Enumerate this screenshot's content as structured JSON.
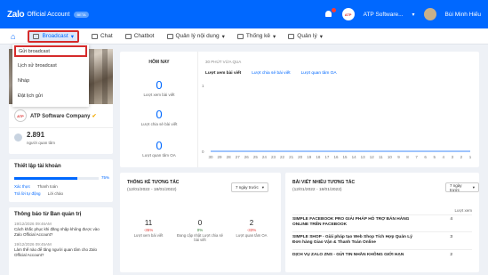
{
  "app": {
    "logo": "Zalo",
    "product": "Official Account",
    "badge": "BETA",
    "account_name": "ATP Software...",
    "account_logo": "ATP",
    "user_name": "Bùi Minh Hiếu"
  },
  "nav": {
    "items": [
      {
        "label": "Broadcast",
        "icon": "broadcast-icon"
      },
      {
        "label": "Chat",
        "icon": "chat-icon"
      },
      {
        "label": "Chatbot",
        "icon": "chatbot-icon"
      },
      {
        "label": "Quản lý nội dung",
        "icon": "content-icon"
      },
      {
        "label": "Thống kê",
        "icon": "stats-icon"
      },
      {
        "label": "Quản lý",
        "icon": "manage-icon"
      }
    ]
  },
  "dropdown": {
    "items": [
      "Gửi broadcast",
      "Lịch sử broadcast",
      "Nháp",
      "Đặt lịch gửi"
    ]
  },
  "profile": {
    "logo": "ATP",
    "name": "ATP Software Company",
    "followers": "2.891",
    "followers_label": "người quan tâm"
  },
  "setup": {
    "title": "Thiết lập tài khoản",
    "progress_percent": 75,
    "progress_label": "75%",
    "line1": [
      "Xác thực",
      "Thanh toán"
    ],
    "line2": [
      "Trả lời tự động",
      "Lời chào"
    ]
  },
  "notices": {
    "title": "Thông báo từ Ban quản trị",
    "items": [
      {
        "date": "19/12/2026 09:46AM",
        "text": "Cách khắc phục khi đăng nhập không được vào Zalo Official Account?"
      },
      {
        "date": "19/12/2026 09:45AM",
        "text": "Làm thế nào để tăng người quan tâm cho Zalo Official Account?"
      }
    ]
  },
  "today": {
    "title": "HÔM NAY",
    "stats": [
      {
        "value": "0",
        "label": "Lượt xem bài viết"
      },
      {
        "value": "0",
        "label": "Lượt chia sẻ bài viết"
      },
      {
        "value": "0",
        "label": "Lượt quan tâm OA"
      }
    ]
  },
  "chart": {
    "header": "30 PHÚT VỪA QUA",
    "tabs": [
      "Lượt xem bài viết",
      "Lượt chia sẻ bài viết",
      "Lượt quan tâm OA"
    ]
  },
  "chart_data": {
    "type": "line",
    "title": "",
    "xlabel": "",
    "ylabel": "",
    "x": [
      30,
      29,
      28,
      27,
      26,
      25,
      24,
      23,
      22,
      21,
      20,
      19,
      18,
      17,
      16,
      15,
      14,
      13,
      12,
      11,
      10,
      9,
      8,
      7,
      6,
      5,
      4,
      3,
      2,
      1
    ],
    "series": [
      {
        "values": [
          0,
          0,
          0,
          0,
          0,
          0,
          0,
          0,
          0,
          0,
          0,
          0,
          0,
          0,
          0,
          0,
          0,
          0,
          0,
          0,
          0,
          0,
          0,
          0,
          0,
          0,
          0,
          0,
          0,
          0
        ]
      }
    ],
    "y_ticks": [
      "1",
      "0"
    ],
    "ylim": [
      0,
      1
    ],
    "grid": false
  },
  "interaction": {
    "title": "THỐNG KÊ TƯƠNG TÁC",
    "range": "(12/01/2022 - 18/01/2022)",
    "select": "7 ngày trước",
    "stats": [
      {
        "value": "11",
        "delta": "-35%",
        "label": "Lượt xem bài viết"
      },
      {
        "value": "0",
        "delta": "0%",
        "label": "Đang cập nhật Lượt chia sẻ bài viết"
      },
      {
        "value": "2",
        "delta": "-33%",
        "label": "Lượt quan tâm OA"
      }
    ]
  },
  "top_posts": {
    "title": "BÀI VIẾT NHIỀU TƯƠNG TÁC",
    "range": "(12/01/2022 - 18/01/2022)",
    "select": "7 ngày trước",
    "column": "Lượt xem",
    "rows": [
      {
        "title": "SIMPLE FACEBOOK PRO GIẢI PHÁP HỖ TRỢ BÁN HÀNG ONLINE TRÊN FACEBOOK",
        "value": "4"
      },
      {
        "title": "SIMPLE SHOP - Giải pháp tạo Web Shop Tích Hợp Quản Lý Đơn hàng Giao Vận & Thanh Toán Online",
        "value": "3"
      },
      {
        "title": "DỊCH VỤ ZALO ZNS - GỬI TIN NHẮN KHÔNG GIỚI HẠN",
        "value": "2"
      }
    ]
  }
}
